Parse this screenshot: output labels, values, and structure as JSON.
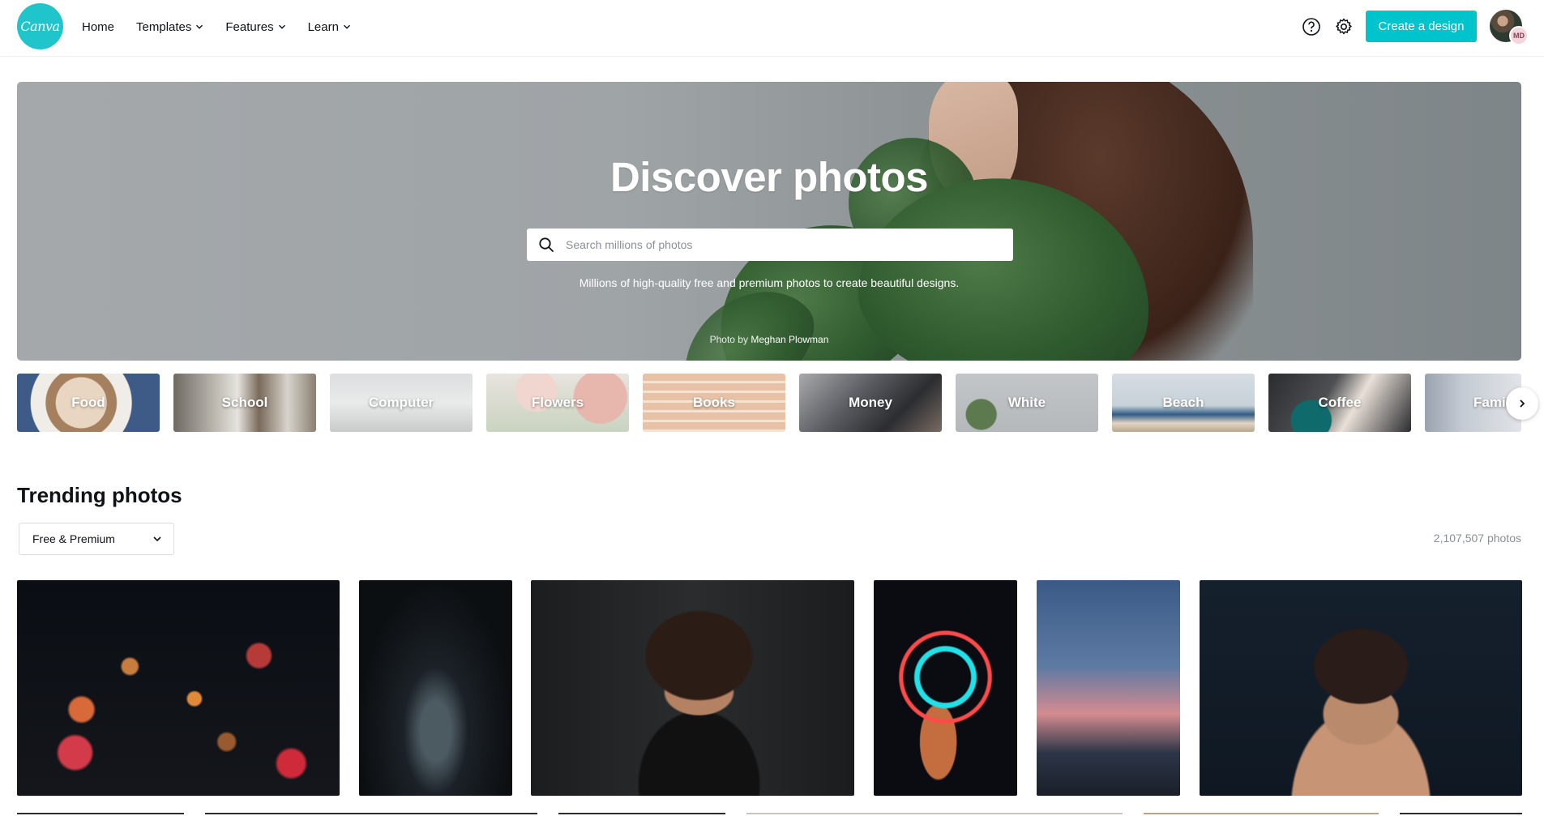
{
  "header": {
    "logo_text": "Canva",
    "nav": [
      {
        "label": "Home",
        "has_menu": false
      },
      {
        "label": "Templates",
        "has_menu": true
      },
      {
        "label": "Features",
        "has_menu": true
      },
      {
        "label": "Learn",
        "has_menu": true
      }
    ],
    "create_label": "Create a design",
    "avatar_initials": "MD",
    "accent_color": "#00c4cc"
  },
  "hero": {
    "title": "Discover photos",
    "search_placeholder": "Search millions of photos",
    "subtitle": "Millions of high-quality free and premium photos to create beautiful designs.",
    "credit_prefix": "Photo by",
    "credit_author": "Meghan Plowman"
  },
  "categories": [
    {
      "label": "Food"
    },
    {
      "label": "School"
    },
    {
      "label": "Computer"
    },
    {
      "label": "Flowers"
    },
    {
      "label": "Books"
    },
    {
      "label": "Money"
    },
    {
      "label": "White"
    },
    {
      "label": "Beach"
    },
    {
      "label": "Coffee"
    },
    {
      "label": "Family"
    }
  ],
  "trending": {
    "title": "Trending photos",
    "filter_value": "Free & Premium",
    "count": "2,107,507 photos"
  }
}
